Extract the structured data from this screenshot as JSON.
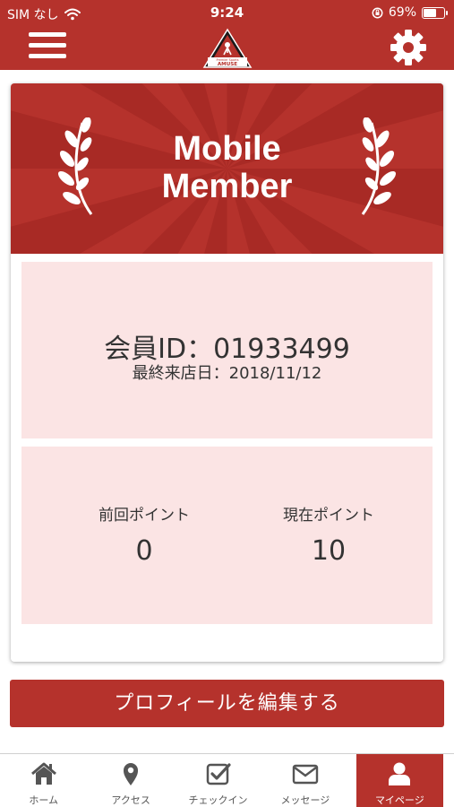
{
  "status_bar": {
    "carrier": "SIM なし",
    "time": "9:24",
    "battery": "69%",
    "battery_level": 0.69,
    "icons": [
      "wifi-icon",
      "orientation-lock-icon",
      "battery-icon"
    ]
  },
  "header": {
    "menu_icon": "hamburger-menu-icon",
    "logo_text_top": "Premier Sports",
    "logo_text": "AMUSE",
    "settings_icon": "gear-icon"
  },
  "card": {
    "banner": {
      "title_line1": "Mobile",
      "title_line2": "Member"
    },
    "member_id": "会員ID：01933499",
    "last_visit": "最終来店日：2018/11/12",
    "points": {
      "previous_label": "前回ポイント",
      "previous_value": "0",
      "current_label": "現在ポイント",
      "current_value": "10"
    }
  },
  "edit_profile_label": "プロフィールを編集する",
  "tabs": [
    {
      "label": "ホーム",
      "icon": "home-icon"
    },
    {
      "label": "アクセス",
      "icon": "map-pin-icon"
    },
    {
      "label": "チェックイン",
      "icon": "checkbox-icon"
    },
    {
      "label": "メッセージ",
      "icon": "envelope-icon"
    },
    {
      "label": "マイページ",
      "icon": "user-icon",
      "active": true
    }
  ],
  "colors": {
    "brand_red": "#b5322c",
    "panel_pink": "#fbe4e4",
    "text": "#333333"
  }
}
